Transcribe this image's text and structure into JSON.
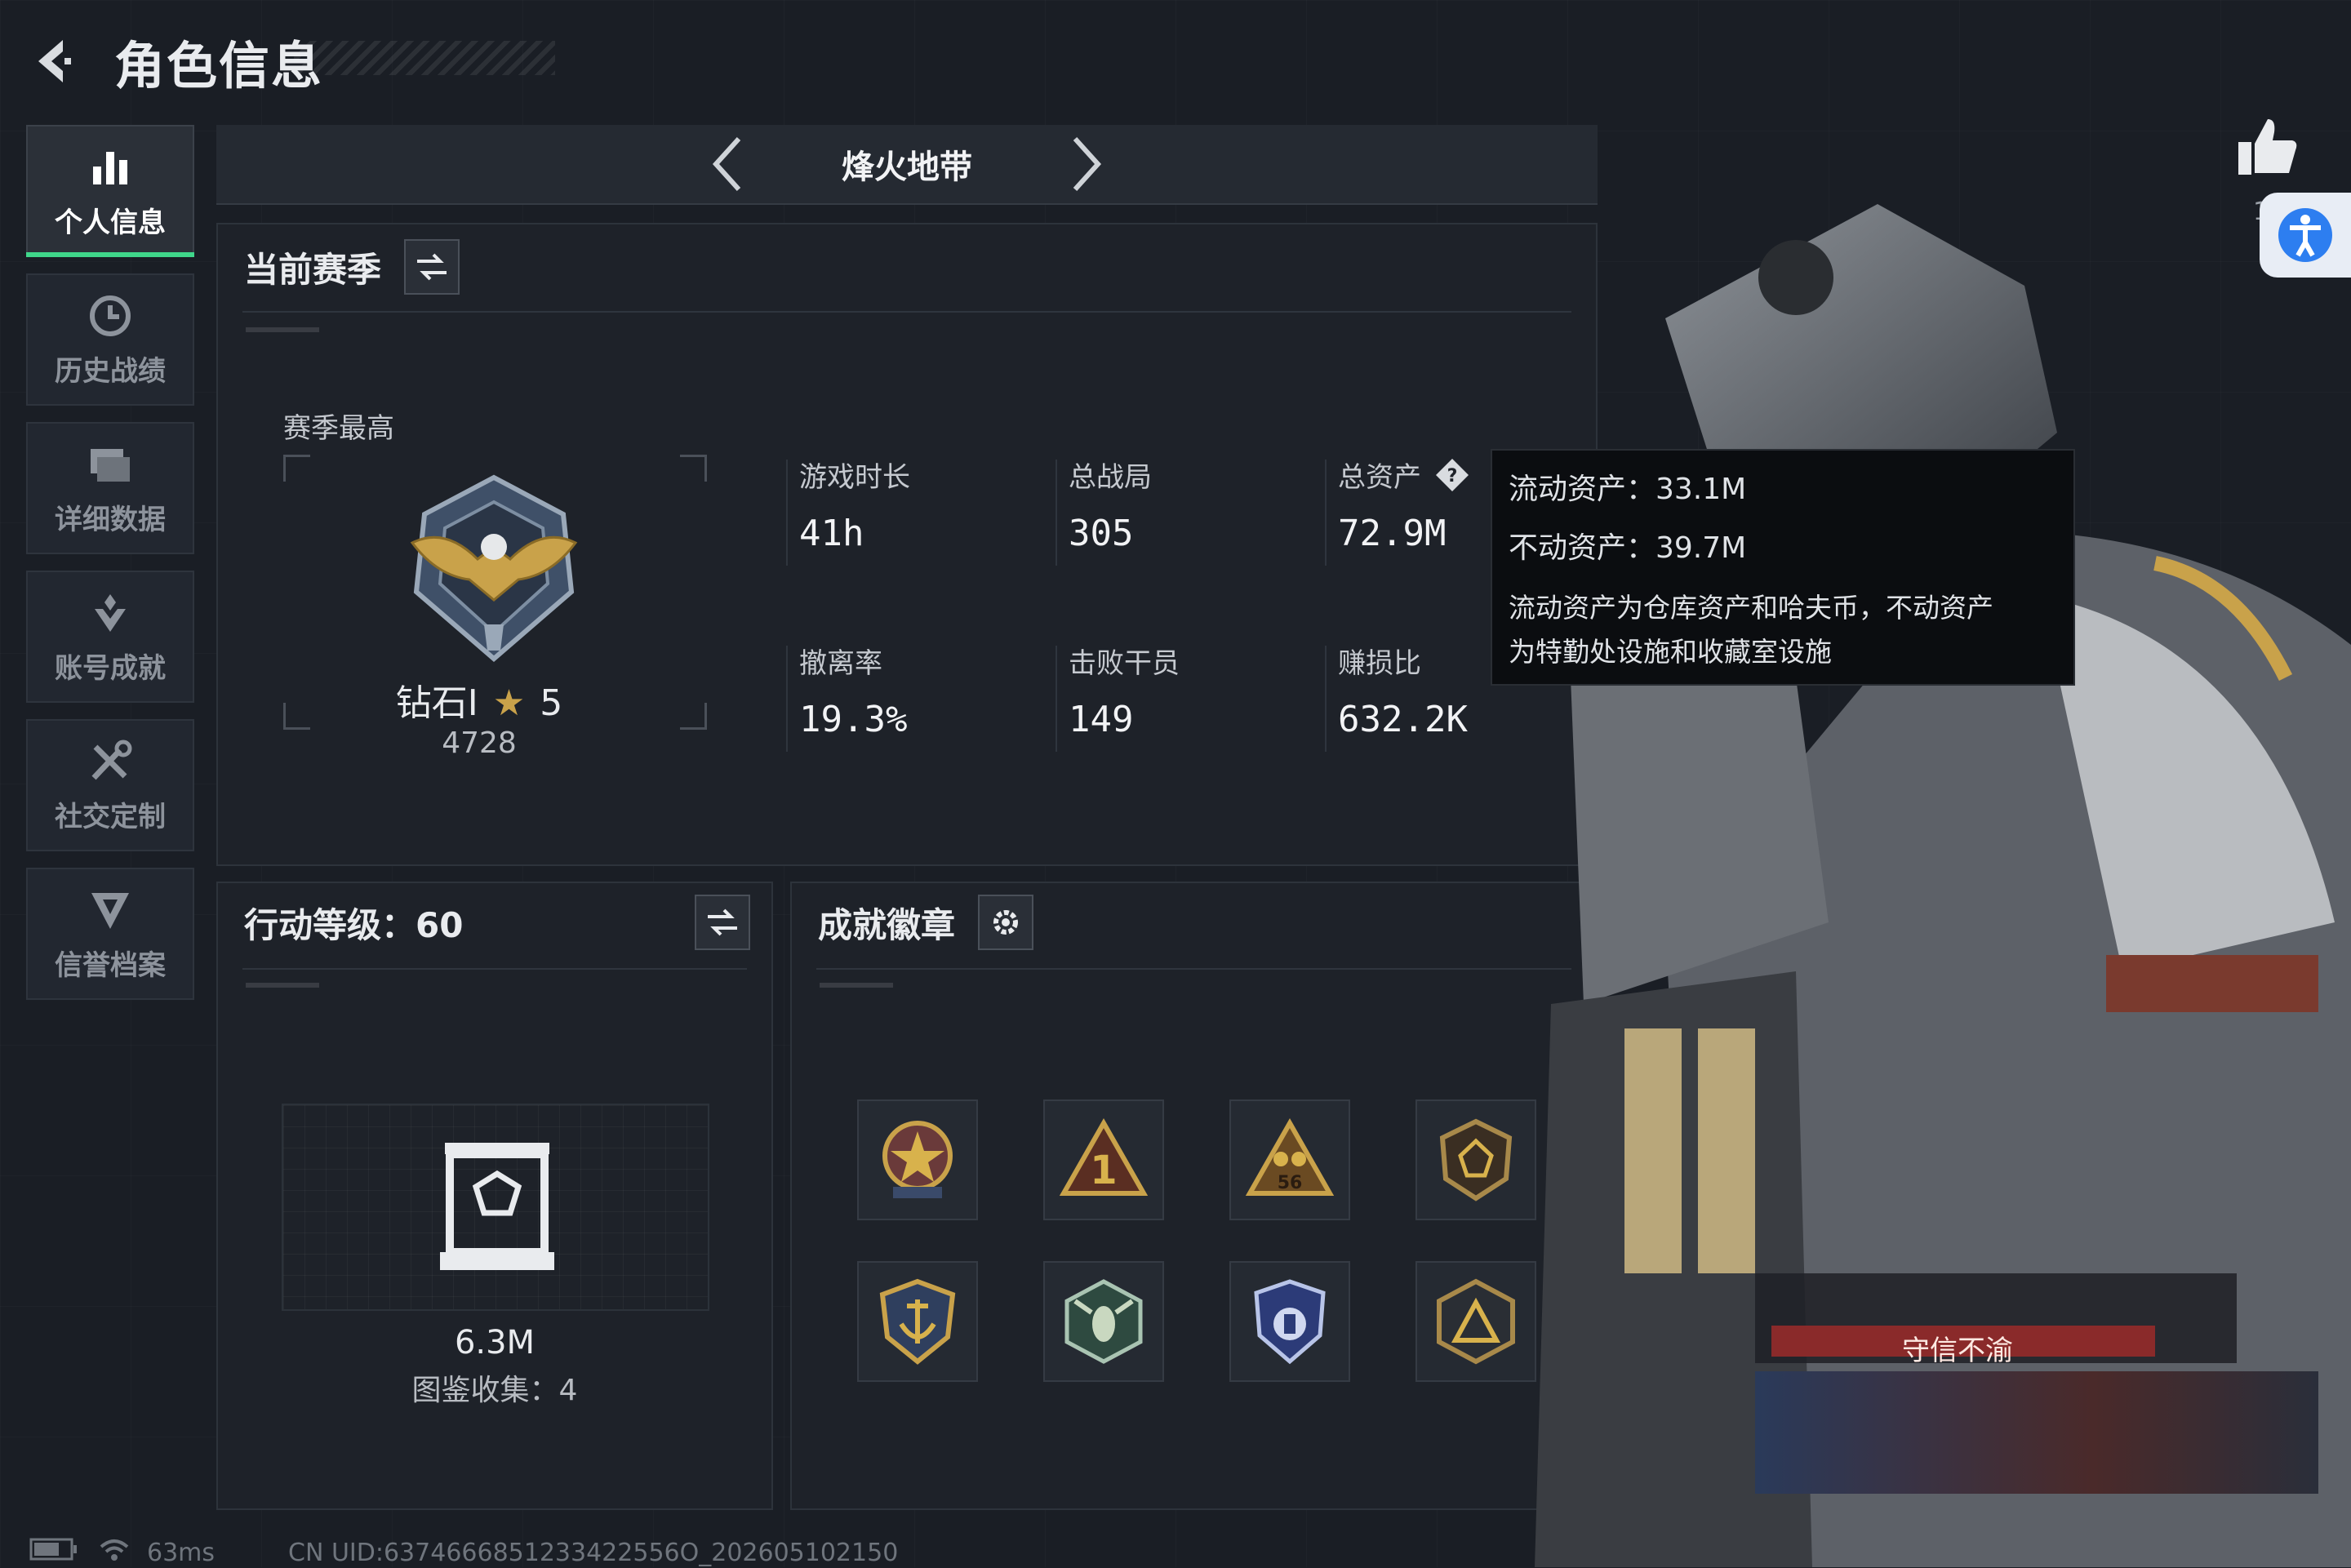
{
  "header": {
    "title": "角色信息",
    "back_icon": "back-arrow-icon"
  },
  "sidebar": {
    "items": [
      {
        "label": "个人信息",
        "icon": "bar-chart-icon",
        "active": true
      },
      {
        "label": "历史战绩",
        "icon": "history-clock-icon",
        "active": false
      },
      {
        "label": "详细数据",
        "icon": "folder-icon",
        "active": false
      },
      {
        "label": "账号成就",
        "icon": "achievement-icon",
        "active": false
      },
      {
        "label": "社交定制",
        "icon": "tools-icon",
        "active": false
      },
      {
        "label": "信誉档案",
        "icon": "shield-icon",
        "active": false
      }
    ]
  },
  "mode": {
    "name": "烽火地带"
  },
  "season": {
    "title": "当前赛季",
    "best_label": "赛季最高",
    "rank": "钻石Ⅰ",
    "stars": "5",
    "score": "4728",
    "stats": [
      {
        "label": "游戏时长",
        "value": "41h"
      },
      {
        "label": "总战局",
        "value": "305"
      },
      {
        "label": "总资产",
        "value": "72.9M"
      },
      {
        "label": "撤离率",
        "value": "19.3%"
      },
      {
        "label": "击败干员",
        "value": "149"
      },
      {
        "label": "赚损比",
        "value": "632.2K"
      }
    ]
  },
  "tooltip": {
    "liquid": "流动资产：33.1M",
    "fixed": "不动资产：39.7M",
    "desc_line1": "流动资产为仓库资产和哈夫币，不动资产",
    "desc_line2": "为特勤处设施和收藏室设施"
  },
  "action_level": {
    "title": "行动等级：60",
    "value": "6.3M",
    "collection": "图鉴收集：4"
  },
  "achievements": {
    "title": "成就徽章",
    "badges": [
      "star-medal-icon",
      "rank-one-triangle-icon",
      "56-triangle-icon",
      "hexagon-shield-icon",
      "anchor-shield-icon",
      "hexagon-bee-icon",
      "blue-shield-icon",
      "triangle-shield-icon"
    ]
  },
  "character": {
    "honor_title": "守信不渝",
    "like_count": "1"
  },
  "footer": {
    "ping": "63ms",
    "uid": "CN UID:6374666851233422556O_202605102150"
  },
  "colors": {
    "accent": "#3fd68a",
    "panel": "#1e2229",
    "background": "#1a1e25"
  }
}
